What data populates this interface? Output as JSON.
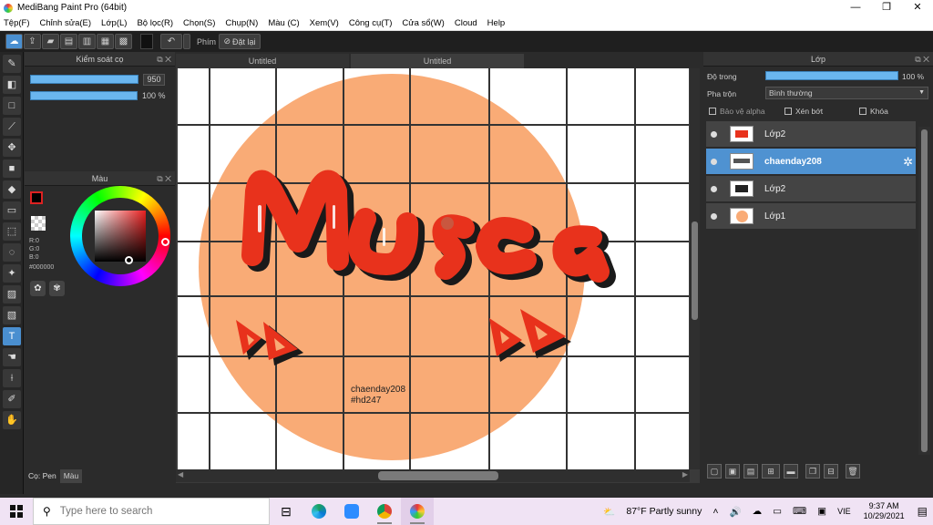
{
  "window": {
    "title": "MediBang Paint Pro (64bit)",
    "min": "—",
    "max": "❐",
    "close": "✕"
  },
  "menu": [
    "Tệp(F)",
    "Chỉnh sửa(E)",
    "Lớp(L)",
    "Bộ lọc(R)",
    "Chọn(S)",
    "Chụp(N)",
    "Màu (C)",
    "Xem(V)",
    "Công cụ(T)",
    "Cửa sổ(W)",
    "Cloud",
    "Help"
  ],
  "toolbar": {
    "stabilizer_label": "Phím",
    "undo_label": "Đặt lại"
  },
  "brush_panel": {
    "title": "Kiểm soát cọ",
    "size_value": "950",
    "opacity_value": "100 %",
    "size_fraction": 0.95,
    "opacity_fraction": 1.0
  },
  "color_panel": {
    "title": "Màu",
    "r": "R:0",
    "g": "G:0",
    "b": "B:0",
    "hex": "#000000"
  },
  "bottom_tabs": [
    "Cọ: Pen",
    "Màu"
  ],
  "doc_tabs": [
    "Untitled",
    "Untitled"
  ],
  "canvas": {
    "text_line1": "chaenday208",
    "text_line2": "#hd247",
    "colors": {
      "circle": "#f9ab76",
      "lettering": "#e8321c",
      "shadow": "#1a1a1a",
      "grid": "#333333"
    }
  },
  "layer_panel": {
    "title": "Lớp",
    "opacity_label": "Độ trong",
    "opacity_value": "100 %",
    "opacity_fraction": 1.0,
    "blend_label": "Pha trộn",
    "blend_value": "Bình thường",
    "protect_alpha": "Bảo vệ alpha",
    "clipping": "Xén bớt",
    "lock": "Khóa",
    "layers": [
      {
        "name": "Lớp2",
        "selected": false
      },
      {
        "name": "chaenday208",
        "selected": true
      },
      {
        "name": "Lớp2",
        "selected": false
      },
      {
        "name": "Lớp1",
        "selected": false
      }
    ]
  },
  "taskbar": {
    "search_placeholder": "Type here to search",
    "weather": "87°F  Partly sunny",
    "lang": "VIE",
    "time": "9:37 AM",
    "date": "10/29/2021"
  }
}
